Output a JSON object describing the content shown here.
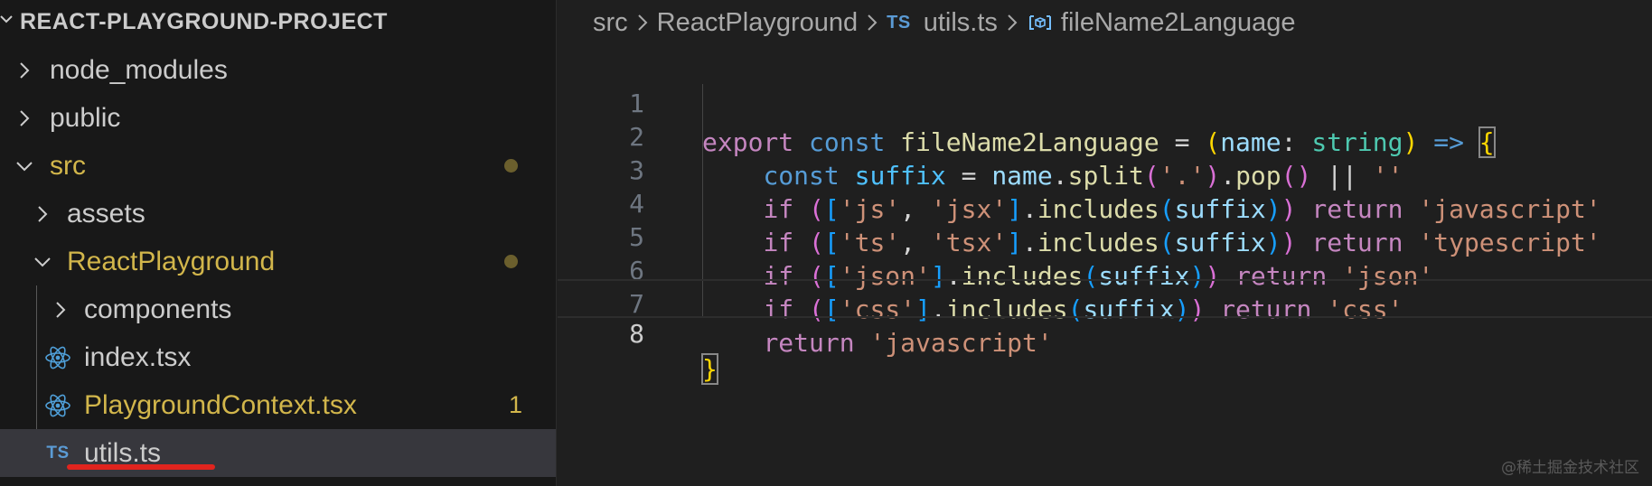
{
  "explorer": {
    "project_title": "REACT-PLAYGROUND-PROJECT",
    "items": [
      {
        "label": "node_modules",
        "type": "folder",
        "expanded": false
      },
      {
        "label": "public",
        "type": "folder",
        "expanded": false
      },
      {
        "label": "src",
        "type": "folder",
        "expanded": true,
        "modified": true
      },
      {
        "label": "assets",
        "type": "folder",
        "expanded": false
      },
      {
        "label": "ReactPlayground",
        "type": "folder",
        "expanded": true,
        "modified": true
      },
      {
        "label": "components",
        "type": "folder",
        "expanded": false
      },
      {
        "label": "index.tsx",
        "type": "react-file",
        "icon": "react-icon"
      },
      {
        "label": "PlaygroundContext.tsx",
        "type": "react-file",
        "icon": "react-icon",
        "problems": "1",
        "modified": true
      },
      {
        "label": "utils.ts",
        "type": "ts-file",
        "icon_text": "TS",
        "selected": true
      }
    ]
  },
  "breadcrumb": {
    "items": [
      "src",
      "ReactPlayground",
      "utils.ts",
      "fileName2Language"
    ],
    "file_icon_text": "TS"
  },
  "editor": {
    "line_numbers": [
      "1",
      "2",
      "3",
      "4",
      "5",
      "6",
      "7",
      "8"
    ],
    "active_line": "8",
    "lines": [
      "export const fileName2Language = (name: string) => {",
      "    const suffix = name.split('.').pop() || ''",
      "    if (['js', 'jsx'].includes(suffix)) return 'javascript'",
      "    if (['ts', 'tsx'].includes(suffix)) return 'typescript'",
      "    if (['json'].includes(suffix)) return 'json'",
      "    if (['css'].includes(suffix)) return 'css'",
      "    return 'javascript'",
      "}"
    ]
  },
  "watermark": "@稀土掘金技术社区",
  "colors": {
    "modified": "#d2b64b",
    "selection": "#37373d",
    "underline_annotation": "#e0241e",
    "keyword": "#c586c0",
    "storage": "#569cd6",
    "function": "#dcdcaa",
    "variable": "#9cdcfe",
    "string": "#ce9178",
    "type": "#4ec9b0"
  }
}
